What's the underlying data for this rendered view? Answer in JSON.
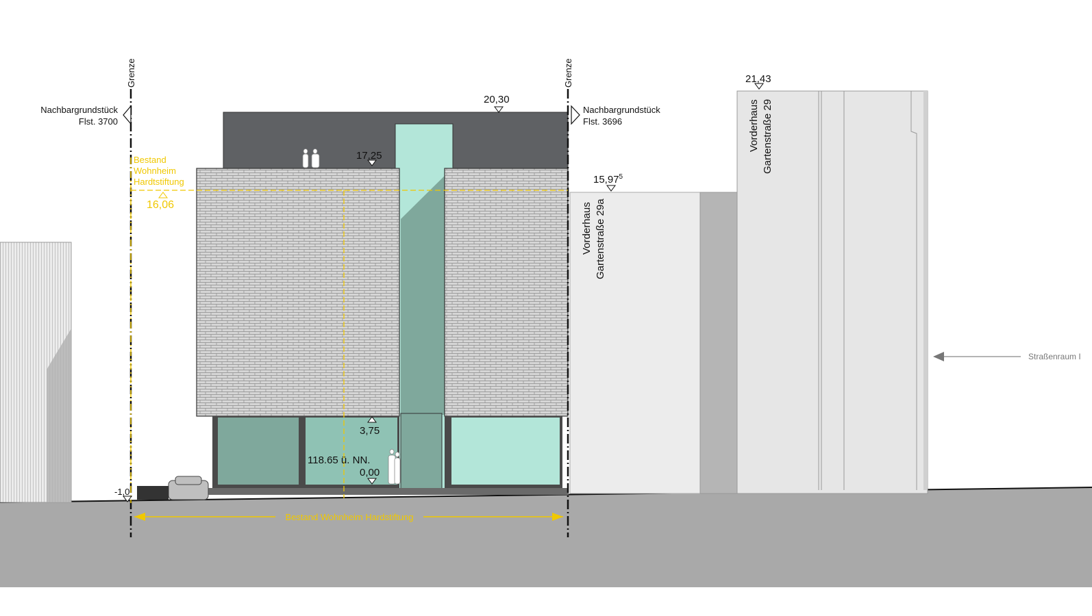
{
  "grenze_left": "Grenze",
  "grenze_right": "Grenze",
  "neighbor_left": {
    "line1": "Nachbargrundstück",
    "line2": "Flst. 3700"
  },
  "neighbor_right": {
    "line1": "Nachbargrundstück",
    "line2": "Flst. 3696"
  },
  "existing": {
    "line1": "Bestand",
    "line2": "Wohnheim",
    "line3": "Hardtstiftung",
    "level": "16,06"
  },
  "levels": {
    "roof": "20,30",
    "terrace": "17,25",
    "first_floor": "3,75",
    "ground_zero": "0,00",
    "nn": "118.65 ü. NN.",
    "basement": "-1,0",
    "neighbor_29a": "15,97",
    "neighbor_29a_sup": "5",
    "neighbor_29": "21,43"
  },
  "buildings": {
    "house_29a": {
      "line1": "Vorderhaus",
      "line2": "Gartenstraße 29a"
    },
    "house_29": {
      "line1": "Vorderhaus",
      "line2": "Gartenstraße 29"
    }
  },
  "dimension_label": "Bestand Wohnheim Hardstiftung",
  "street_label": "Straßenraum I",
  "colors": {
    "accent": "#f0c800",
    "glass": "#b3e6d9",
    "glass_dark": "#7fa89c",
    "dark_volume": "#5f6164",
    "ground": "#a8a8a8"
  }
}
